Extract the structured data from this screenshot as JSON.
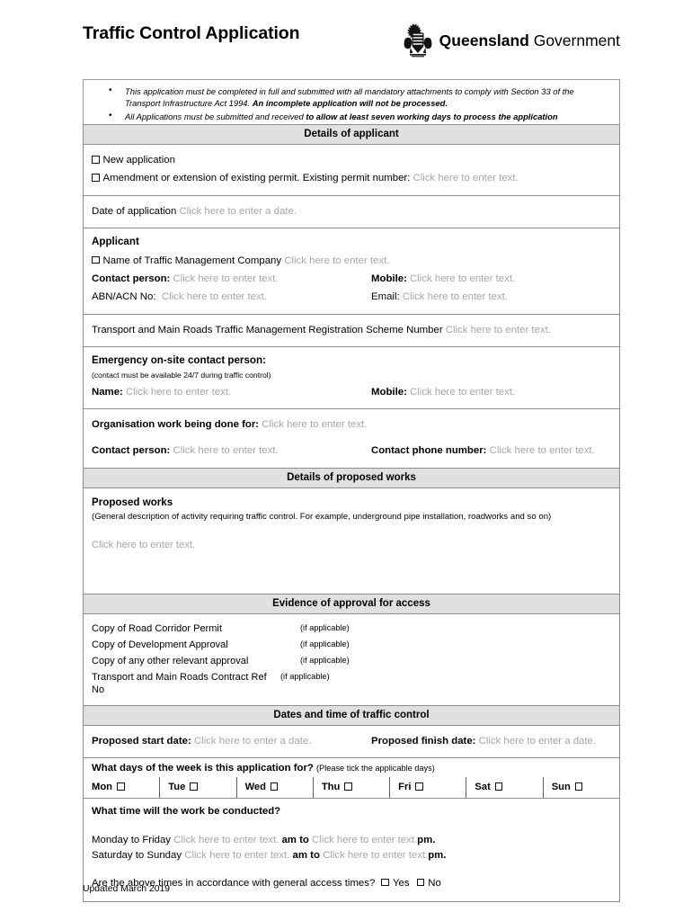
{
  "header": {
    "title": "Traffic Control Application",
    "logo": {
      "crest_alt": "queensland-state-crest",
      "word_bold": "Queensland",
      "word_light": " Government"
    }
  },
  "notice": {
    "bullets": [
      {
        "plain_1": "This application must be completed in full and submitted with all mandatory attachments to comply with Section 33 of the Transport Infrastructure Act 1994. ",
        "bold": "An incomplete application will not be processed.",
        "plain_2": ""
      },
      {
        "plain_1": "All Applications must be submitted and received ",
        "bold": "to allow at least seven working days to process the application",
        "plain_2": ""
      }
    ]
  },
  "placeholders": {
    "text": "Click here to enter text.",
    "date": "Click here to enter a date."
  },
  "sections": {
    "applicant_header": "Details of applicant",
    "proposed_works_header": "Details of proposed works",
    "evidence_header": "Evidence of approval for access",
    "dates_header": "Dates and time of traffic control"
  },
  "applicant": {
    "new_application_label": "New application",
    "amendment_label": "Amendment or extension of existing permit. Existing permit number:",
    "amendment_value": "Click here to enter text.",
    "date_of_application_label": "Date of application",
    "date_of_application_value": "Click here to enter a date.",
    "subheading": "Applicant",
    "company_label": "Name of Traffic Management Company",
    "company_value": "Click here to enter text.",
    "contact_person_label": "Contact person:",
    "contact_person_value": "Click here to enter text.",
    "mobile_label": "Mobile:",
    "mobile_value": "Click here to enter text.",
    "abn_label": "ABN/ACN No:",
    "abn_value": "Click here to enter text.",
    "email_label": "Email:",
    "email_value": "Click here to enter text.",
    "tmr_scheme_label": "Transport and Main Roads Traffic Management Registration Scheme Number",
    "tmr_scheme_value": "Click here to enter text."
  },
  "emergency": {
    "heading": "Emergency on-site contact person:",
    "note": "(contact must be available 24/7 during traffic control)",
    "name_label": "Name:",
    "name_value": "Click here to enter text.",
    "mobile_label": "Mobile:",
    "mobile_value": "Click here to enter text."
  },
  "organisation": {
    "label": "Organisation work being done for:",
    "value": "Click here to enter text.",
    "contact_person_label": "Contact person:",
    "contact_person_value": "Click here to enter text.",
    "contact_phone_label": "Contact phone number:",
    "contact_phone_value": "Click here to enter text."
  },
  "proposed_works": {
    "title": "Proposed works",
    "description": "(General description of activity requiring traffic control. For example, underground pipe installation, roadworks and so on)",
    "value": "Click here to enter text."
  },
  "evidence": {
    "items": [
      {
        "name": "Copy of Road Corridor Permit",
        "note": "(if applicable)"
      },
      {
        "name": "Copy of Development Approval",
        "note": "(if applicable)"
      },
      {
        "name": "Copy of any other relevant approval",
        "note": "(if applicable)"
      },
      {
        "name": "Transport and Main Roads Contract Ref No",
        "note": "(if applicable)"
      }
    ]
  },
  "dates": {
    "start_label": "Proposed start date:",
    "start_value": "Click here to enter a date.",
    "finish_label": "Proposed finish date:",
    "finish_value": "Click here to enter a date."
  },
  "days_of_week": {
    "question": "What days of the week is this application for?",
    "note": "(Please tick the applicable days)",
    "days": [
      "Mon",
      "Tue",
      "Wed",
      "Thu",
      "Fri",
      "Sat",
      "Sun"
    ]
  },
  "work_time": {
    "question": "What time will the work be conducted?",
    "weekday_label": "Monday to Friday",
    "weekday_from_value": "Click here to enter text.",
    "weekday_am_to": "am to",
    "weekday_to_value": "Click here to enter text.",
    "weekday_pm": "pm.",
    "weekend_label": "Saturday to Sunday",
    "weekend_from_value": "Click here to enter text.",
    "weekend_am_to": "am to",
    "weekend_to_value": "Click here to enter text.",
    "weekend_pm": "pm.",
    "access_question": "Are the above times in accordance with general access times?",
    "yes_label": "Yes",
    "no_label": "No"
  },
  "footer": {
    "updated": "Updated March 2019"
  }
}
